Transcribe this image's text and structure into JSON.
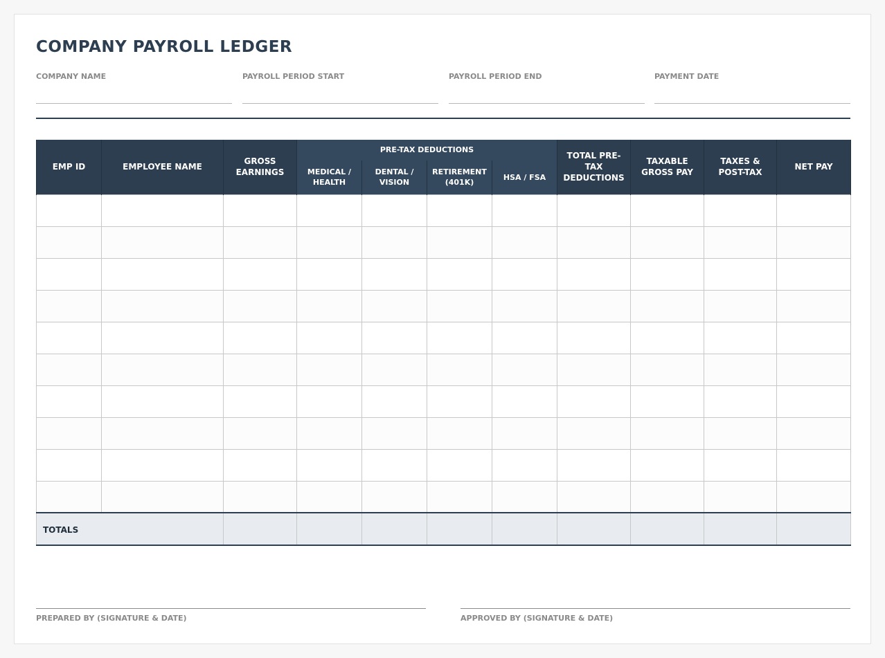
{
  "title": "COMPANY PAYROLL LEDGER",
  "meta_fields": [
    {
      "label": "COMPANY NAME",
      "value": ""
    },
    {
      "label": "PAYROLL PERIOD START",
      "value": ""
    },
    {
      "label": "PAYROLL PERIOD END",
      "value": ""
    },
    {
      "label": "PAYMENT DATE",
      "value": ""
    }
  ],
  "table": {
    "headers": {
      "emp_id": "EMP ID",
      "employee_name": "EMPLOYEE NAME",
      "gross_earnings": "GROSS EARNINGS",
      "pre_tax_group": "PRE-TAX DEDUCTIONS",
      "medical_health": "MEDICAL / HEALTH",
      "dental_vision": "DENTAL / VISION",
      "retirement": "RETIREMENT (401K)",
      "hsa_fsa": "HSA / FSA",
      "total_pre_tax": "TOTAL PRE-TAX DEDUCTIONS",
      "taxable_gross": "TAXABLE GROSS PAY",
      "taxes_post_tax": "TAXES & POST-TAX",
      "net_pay": "NET PAY"
    },
    "rows": [
      [
        "",
        "",
        "",
        "",
        "",
        "",
        "",
        "",
        "",
        "",
        ""
      ],
      [
        "",
        "",
        "",
        "",
        "",
        "",
        "",
        "",
        "",
        "",
        ""
      ],
      [
        "",
        "",
        "",
        "",
        "",
        "",
        "",
        "",
        "",
        "",
        ""
      ],
      [
        "",
        "",
        "",
        "",
        "",
        "",
        "",
        "",
        "",
        "",
        ""
      ],
      [
        "",
        "",
        "",
        "",
        "",
        "",
        "",
        "",
        "",
        "",
        ""
      ],
      [
        "",
        "",
        "",
        "",
        "",
        "",
        "",
        "",
        "",
        "",
        ""
      ],
      [
        "",
        "",
        "",
        "",
        "",
        "",
        "",
        "",
        "",
        "",
        ""
      ],
      [
        "",
        "",
        "",
        "",
        "",
        "",
        "",
        "",
        "",
        "",
        ""
      ],
      [
        "",
        "",
        "",
        "",
        "",
        "",
        "",
        "",
        "",
        "",
        ""
      ],
      [
        "",
        "",
        "",
        "",
        "",
        "",
        "",
        "",
        "",
        "",
        ""
      ]
    ],
    "totals": {
      "label": "TOTALS",
      "values": [
        "",
        "",
        "",
        "",
        "",
        "",
        "",
        "",
        ""
      ]
    }
  },
  "signatures": {
    "prepared_by": "PREPARED BY (SIGNATURE & DATE)",
    "approved_by": "APPROVED BY (SIGNATURE & DATE)"
  },
  "colors": {
    "header_dark": "#2d3e50",
    "header_sub": "#34495e",
    "totals_bg": "#e8ecf1",
    "label_gray": "#8a8a8a"
  }
}
